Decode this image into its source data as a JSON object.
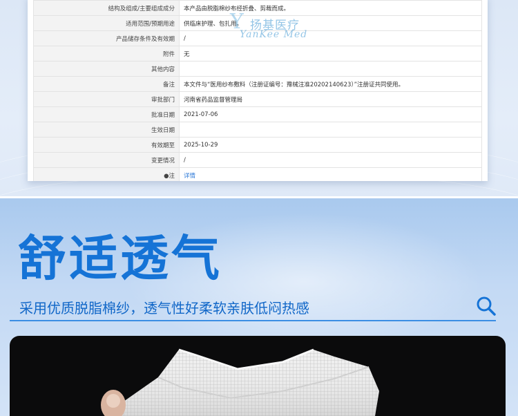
{
  "registration_table": {
    "rows": [
      {
        "key": "结构及组成/主要组成成分",
        "value": "本产品由脱脂棉纱布经折叠、剪裁而成。"
      },
      {
        "key": "适用范围/预期用途",
        "value": "供临床护理、包扎用。"
      },
      {
        "key": "产品储存条件及有效期",
        "value": "/"
      },
      {
        "key": "附件",
        "value": "无"
      },
      {
        "key": "其他内容",
        "value": ""
      },
      {
        "key": "备注",
        "value": "本文件与“医用纱布敷料（注册证编号：豫械注准20202140623）”注册证共同使用。"
      },
      {
        "key": "审批部门",
        "value": "河南省药品监督管理局"
      },
      {
        "key": "批准日期",
        "value": "2021-07-06"
      },
      {
        "key": "生效日期",
        "value": ""
      },
      {
        "key": "有效期至",
        "value": "2025-10-29"
      },
      {
        "key": "变更情况",
        "value": "/"
      },
      {
        "key": "●注",
        "value": "详情"
      }
    ]
  },
  "watermark": {
    "cn": "扬基医疗",
    "en": "YanKee Med"
  },
  "feature": {
    "headline": "舒适透气",
    "subline": "采用优质脱脂棉纱，透气性好柔软亲肤低闷热感"
  },
  "colors": {
    "accent": "#1573d6",
    "link": "#2f7bd8"
  },
  "icons": {
    "search": "search-icon"
  }
}
